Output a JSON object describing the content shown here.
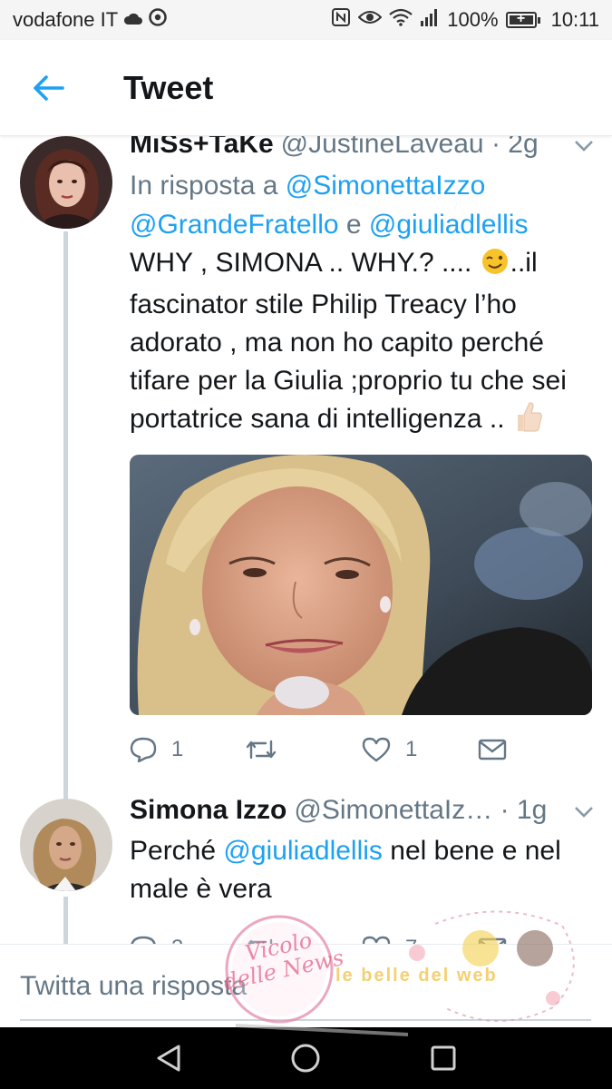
{
  "status_bar": {
    "carrier": "vodafone IT",
    "battery": "100%",
    "battery_level": 1.0,
    "time": "10:11",
    "icons": [
      "cloud-icon",
      "chrome-icon",
      "nfc-icon",
      "eye-icon",
      "wifi-icon",
      "signal-icon",
      "battery-icon"
    ]
  },
  "header": {
    "back_icon": "arrow-left-icon",
    "title": "Tweet"
  },
  "tweets": [
    {
      "name": "MiSs+TaKe",
      "handle": "@JustineLaveau",
      "separator": " · ",
      "time": "2g",
      "reply_prefix": "In risposta a ",
      "reply_user_1": "@SimonettaIzzo",
      "reply_user_2": "@GrandeFratello",
      "reply_and": " e ",
      "reply_user_3": "@giuliadlellis",
      "text_part_1": "WHY , SIMONA .. WHY.? .... ",
      "emoji_1": "wink-emoji",
      "text_part_2": "..il fascinator stile Philip Treacy l’ho adorato , ma non ho capito perché tifare per la Giulia ;proprio tu che sei portatrice sana di intelligenza .. ",
      "emoji_2": "thumbs-up-emoji",
      "media_description": "photo-of-blonde-woman",
      "replies": "1",
      "retweets": "",
      "likes": "1"
    },
    {
      "name": "Simona Izzo",
      "handle": "@SimonettaIz…",
      "separator": " · ",
      "time": "1g",
      "text_prefix": "Perché ",
      "mention": "@giuliadlellis",
      "text_suffix": " nel bene e nel male è vera",
      "replies": "3",
      "likes": "7"
    }
  ],
  "reply_bar": {
    "placeholder": "Twitta una risposta"
  },
  "watermark": {
    "text_1": "Vicolo delle News",
    "text_2": "le belle del web"
  },
  "colors": {
    "link": "#1da1f2",
    "text": "#14171a",
    "secondary": "#657786",
    "thread_line": "#ccd6dd"
  }
}
